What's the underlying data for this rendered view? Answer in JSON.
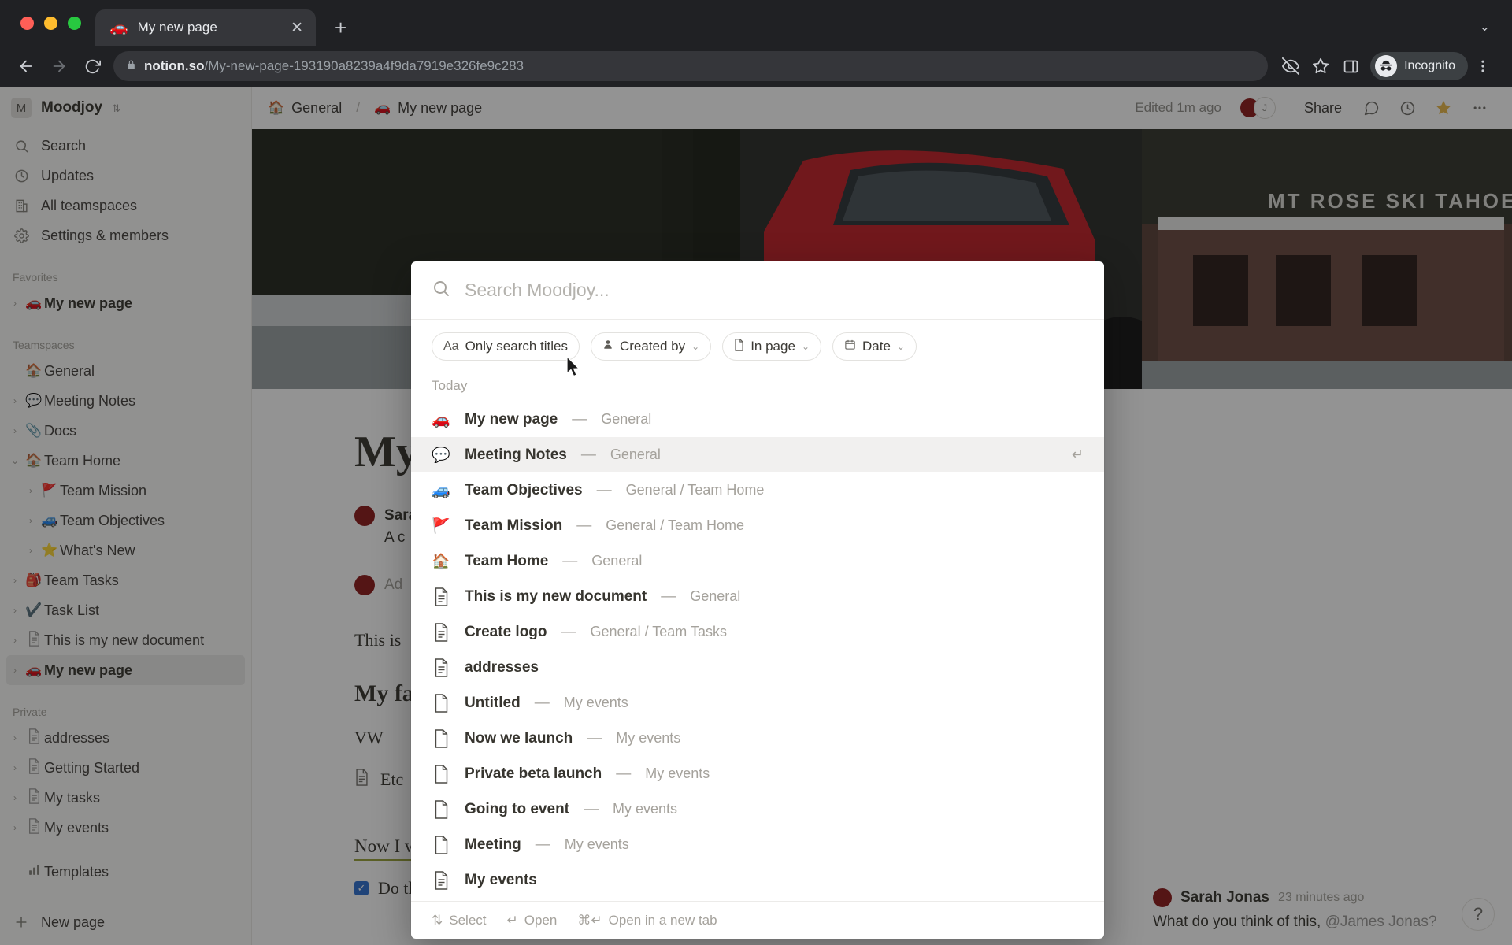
{
  "browser": {
    "tab": {
      "favicon": "car-emoji",
      "title": "My new page",
      "close_icon": "close-icon"
    },
    "new_tab_icon": "plus-icon",
    "tab_list_icon": "chevron-down-icon",
    "back_icon": "back-arrow-icon",
    "forward_icon": "forward-arrow-icon",
    "reload_icon": "reload-icon",
    "lock_icon": "lock-icon",
    "url_domain": "notion.so",
    "url_path": "/My-new-page-193190a8239a4f9da7919e326fe9c283",
    "eye_off_icon": "eye-off-icon",
    "bookmark_icon": "star-outline-icon",
    "sidepanel_icon": "side-panel-icon",
    "incognito_label": "Incognito",
    "incognito_icon": "incognito-icon",
    "menu_icon": "kebab-menu-icon"
  },
  "sidebar": {
    "workspace": {
      "initial": "M",
      "name": "Moodjoy",
      "switcher_icon": "chevron-updown-icon"
    },
    "nav": [
      {
        "label": "Search",
        "icon": "search-icon"
      },
      {
        "label": "Updates",
        "icon": "clock-icon"
      },
      {
        "label": "All teamspaces",
        "icon": "building-icon"
      },
      {
        "label": "Settings & members",
        "icon": "gear-icon"
      }
    ],
    "favorites_title": "Favorites",
    "favorites": [
      {
        "label": "My new page",
        "emoji": "🚗",
        "indent": 0,
        "bold": true,
        "twisty": "chevron-right-icon"
      }
    ],
    "teamspaces_title": "Teamspaces",
    "teamspaces": [
      {
        "label": "General",
        "emoji": "🏠",
        "indent": 0,
        "bold": false,
        "twisty": ""
      },
      {
        "label": "Meeting Notes",
        "emoji": "💬",
        "indent": 0,
        "bold": false,
        "twisty": "chevron-right-icon"
      },
      {
        "label": "Docs",
        "emoji": "📎",
        "indent": 0,
        "bold": false,
        "twisty": "chevron-right-icon"
      },
      {
        "label": "Team Home",
        "emoji": "🏠",
        "indent": 0,
        "bold": false,
        "twisty": "chevron-down-icon"
      },
      {
        "label": "Team Mission",
        "emoji": "🚩",
        "indent": 1,
        "bold": false,
        "twisty": "chevron-right-icon"
      },
      {
        "label": "Team Objectives",
        "emoji": "🚙",
        "indent": 1,
        "bold": false,
        "twisty": "chevron-right-icon"
      },
      {
        "label": "What's New",
        "emoji": "⭐",
        "indent": 1,
        "bold": false,
        "twisty": "chevron-right-icon"
      },
      {
        "label": "Team Tasks",
        "emoji": "🎒",
        "indent": 0,
        "bold": false,
        "twisty": "chevron-right-icon"
      },
      {
        "label": "Task List",
        "emoji": "✔️",
        "indent": 0,
        "bold": false,
        "twisty": "chevron-right-icon"
      },
      {
        "label": "This is my new document",
        "emoji": "📄",
        "indent": 0,
        "bold": false,
        "twisty": "chevron-right-icon"
      },
      {
        "label": "My new page",
        "emoji": "🚗",
        "indent": 0,
        "bold": true,
        "active": true,
        "twisty": "chevron-right-icon"
      }
    ],
    "private_title": "Private",
    "private": [
      {
        "label": "addresses",
        "emoji": "📄",
        "indent": 0,
        "bold": false,
        "twisty": "chevron-right-icon"
      },
      {
        "label": "Getting Started",
        "emoji": "📄",
        "indent": 0,
        "bold": false,
        "twisty": "chevron-right-icon"
      },
      {
        "label": "My tasks",
        "emoji": "📄",
        "indent": 0,
        "bold": false,
        "twisty": "chevron-right-icon"
      },
      {
        "label": "My events",
        "emoji": "📄",
        "indent": 0,
        "bold": false,
        "twisty": "chevron-right-icon"
      }
    ],
    "templates_label": "Templates",
    "templates_icon": "templates-icon",
    "new_page_label": "New page",
    "new_page_icon": "plus-icon"
  },
  "topbar": {
    "breadcrumb": [
      {
        "emoji": "🏠",
        "label": "General"
      },
      {
        "emoji": "🚗",
        "label": "My new page"
      }
    ],
    "separator": "/",
    "edited": "Edited 1m ago",
    "share_label": "Share",
    "comment_icon": "comment-icon",
    "history_icon": "clock-history-icon",
    "favorite_icon": "star-filled-icon",
    "more_icon": "more-horizontal-icon"
  },
  "page": {
    "title": "My",
    "comment_author": "Sarah Jonas",
    "comment_snippet": "A c",
    "add_comment": "Ad",
    "paragraph": "This is",
    "heading2": "My fa",
    "plain_line": "VW",
    "etc_line": "Etc",
    "underlined_line": "Now I will write a list about tasks I want to do",
    "todo_label": "Do thing",
    "float_comment": {
      "author": "Sarah Jonas",
      "time": "23 minutes ago",
      "text": "What do you think of this, ",
      "mention": "@James Jonas?"
    },
    "help_label": "?"
  },
  "search_modal": {
    "search_icon": "search-icon",
    "placeholder": "Search Moodjoy...",
    "filters": [
      {
        "label": "Only search titles",
        "prefix": "Aa",
        "icon": "",
        "caret": false
      },
      {
        "label": "Created by",
        "prefix": "",
        "icon": "person-icon",
        "caret": true
      },
      {
        "label": "In page",
        "prefix": "",
        "icon": "page-icon",
        "caret": true
      },
      {
        "label": "Date",
        "prefix": "",
        "icon": "calendar-icon",
        "caret": true
      }
    ],
    "group_label": "Today",
    "results": [
      {
        "title": "My new page",
        "path": "General",
        "icon": "🚗",
        "type": "emoji",
        "selected": false
      },
      {
        "title": "Meeting Notes",
        "path": "General",
        "icon": "💬",
        "type": "emoji",
        "selected": true,
        "enter_icon": "enter-key-icon"
      },
      {
        "title": "Team Objectives",
        "path": "General / Team Home",
        "icon": "🚙",
        "type": "emoji",
        "selected": false
      },
      {
        "title": "Team Mission",
        "path": "General / Team Home",
        "icon": "🚩",
        "type": "emoji",
        "selected": false
      },
      {
        "title": "Team Home",
        "path": "General",
        "icon": "🏠",
        "type": "emoji",
        "selected": false
      },
      {
        "title": "This is my new document",
        "path": "General",
        "icon": "doc-lines-icon",
        "type": "doc",
        "selected": false
      },
      {
        "title": "Create logo",
        "path": "General / Team Tasks",
        "icon": "doc-lines-icon",
        "type": "doc",
        "selected": false
      },
      {
        "title": "addresses",
        "path": "",
        "icon": "doc-lines-icon",
        "type": "doc",
        "selected": false
      },
      {
        "title": "Untitled",
        "path": "My events",
        "icon": "doc-blank-icon",
        "type": "blank",
        "selected": false
      },
      {
        "title": "Now we launch",
        "path": "My events",
        "icon": "doc-blank-icon",
        "type": "blank",
        "selected": false
      },
      {
        "title": "Private beta launch",
        "path": "My events",
        "icon": "doc-blank-icon",
        "type": "blank",
        "selected": false
      },
      {
        "title": "Going to event",
        "path": "My events",
        "icon": "doc-blank-icon",
        "type": "blank",
        "selected": false
      },
      {
        "title": "Meeting",
        "path": "My events",
        "icon": "doc-blank-icon",
        "type": "blank",
        "selected": false
      },
      {
        "title": "My events",
        "path": "",
        "icon": "doc-lines-icon",
        "type": "doc",
        "selected": false
      }
    ],
    "separator": "—",
    "footer": [
      {
        "key": "⇅",
        "label": "Select"
      },
      {
        "key": "↵",
        "label": "Open"
      },
      {
        "key": "⌘↵",
        "label": "Open in a new tab"
      }
    ]
  },
  "colors": {
    "chrome_bg": "#202124",
    "tab_bg": "#35363a",
    "sidebar_bg": "#fbfbfa",
    "text_primary": "#37352f",
    "text_muted": "#a5a29c",
    "selected_row": "#f1f0ef",
    "star_gold": "#e9b949",
    "underline_olive": "#9aa33a"
  }
}
